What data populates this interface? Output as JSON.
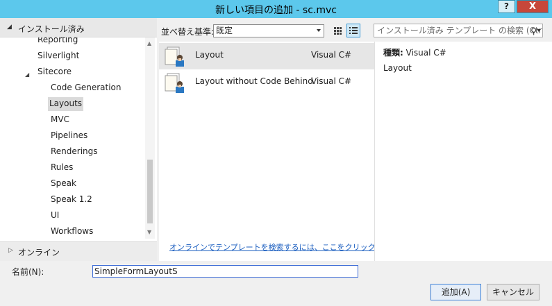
{
  "window": {
    "title": "新しい項目の追加 - sc.mvc",
    "help_label": "?",
    "close_label": "X"
  },
  "sidebar": {
    "header_arrow": "◢",
    "header_label": "インストール済み",
    "items": [
      {
        "label": "Reporting"
      },
      {
        "label": "Silverlight"
      },
      {
        "label": "Sitecore"
      },
      {
        "label": "Code Generation"
      },
      {
        "label": "Layouts"
      },
      {
        "label": "MVC"
      },
      {
        "label": "Pipelines"
      },
      {
        "label": "Renderings"
      },
      {
        "label": "Rules"
      },
      {
        "label": "Speak"
      },
      {
        "label": "Speak 1.2"
      },
      {
        "label": "UI"
      },
      {
        "label": "Workflows"
      }
    ],
    "expand_arrow": "◢",
    "online_arrow": "▷",
    "online_label": "オンライン",
    "scroll_up": "▲",
    "scroll_down": "▼"
  },
  "toolbar": {
    "sort_label": "並べ替え基準:",
    "sort_value": "既定",
    "search_placeholder": "インストール済み テンプレート の検索 (Ctrl+E)",
    "search_icon": "⚲"
  },
  "templates": [
    {
      "name": "Layout",
      "language": "Visual C#"
    },
    {
      "name": "Layout without Code Behind",
      "language": "Visual C#"
    }
  ],
  "online_link": "オンラインでテンプレートを検索するには、ここをクリックします。",
  "details": {
    "type_label": "種類:",
    "type_value": "Visual C#",
    "description": "Layout"
  },
  "name_field": {
    "label": "名前(N):",
    "value": "SimpleFormLayoutS"
  },
  "buttons": {
    "add": "追加(A)",
    "cancel": "キャンセル"
  },
  "colors": {
    "titlebar": "#5cc8ec",
    "close": "#c7473a",
    "selection": "#dadada",
    "link": "#1c5fc0"
  }
}
